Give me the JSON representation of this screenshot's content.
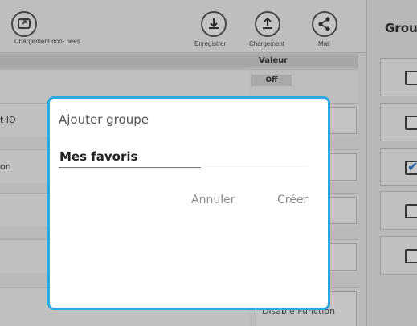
{
  "toolbar": {
    "load_data_label": "Chargement don-\nnées",
    "save_label": "Enregistrer",
    "load_label": "Chargement",
    "mail_label": "Mail"
  },
  "table": {
    "value_header": "Valeur",
    "first_value": "Off",
    "rows": [
      {
        "name": ""
      },
      {
        "name": "t IO"
      },
      {
        "name": "on"
      },
      {
        "name": ""
      },
      {
        "name": ""
      },
      {
        "name": ""
      }
    ],
    "last_value": "Disable Function"
  },
  "right_panel": {
    "title": "Group",
    "checkboxes": [
      {
        "checked": false
      },
      {
        "checked": false
      },
      {
        "checked": true
      },
      {
        "checked": false
      },
      {
        "checked": false
      }
    ]
  },
  "dialog": {
    "title": "Ajouter groupe",
    "input_value": "Mes favoris",
    "cancel_label": "Annuler",
    "create_label": "Créer"
  },
  "colors": {
    "accent": "#2ba9e0",
    "check": "#2a7fd4"
  },
  "icons": {
    "load_data": "screen-arrow-icon",
    "save": "download-icon",
    "load": "upload-icon",
    "mail": "share-icon"
  }
}
